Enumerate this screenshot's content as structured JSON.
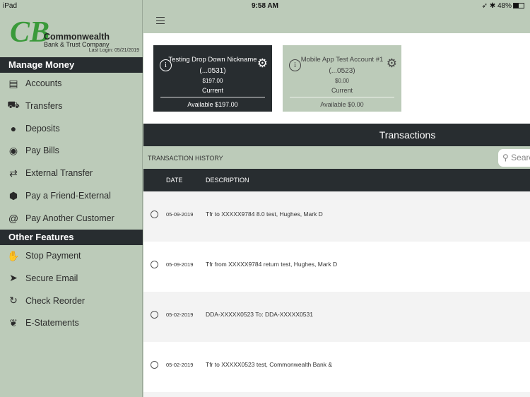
{
  "status": {
    "device": "iPad",
    "time": "9:58 AM",
    "battery": "48%"
  },
  "brand": {
    "name": "Commonwealth",
    "sub": "Bank & Trust Company",
    "last_login": "Last Login: 05/21/2019"
  },
  "sidebar": {
    "manage_header": "Manage Money",
    "manage_items": [
      {
        "label": "Accounts",
        "icon": "▤"
      },
      {
        "label": "Transfers",
        "icon": "⛟"
      },
      {
        "label": "Deposits",
        "icon": "●"
      },
      {
        "label": "Pay Bills",
        "icon": "◉"
      },
      {
        "label": "External Transfer",
        "icon": "⇄"
      },
      {
        "label": "Pay a Friend-External",
        "icon": "⬢"
      },
      {
        "label": "Pay Another Customer",
        "icon": "@"
      }
    ],
    "other_header": "Other Features",
    "other_items": [
      {
        "label": "Stop Payment",
        "icon": "✋"
      },
      {
        "label": "Secure Email",
        "icon": "➤"
      },
      {
        "label": "Check Reorder",
        "icon": "↻"
      },
      {
        "label": "E-Statements",
        "icon": "❦"
      }
    ]
  },
  "cards": [
    {
      "name": "Testing Drop Down Nickname",
      "acct": "(...0531)",
      "balance": "$197.00",
      "status": "Current",
      "available": "Available $197.00"
    },
    {
      "name": "Mobile App Test Account #1",
      "acct": "(...0523)",
      "balance": "$0.00",
      "status": "Current",
      "available": "Available $0.00"
    }
  ],
  "transactions": {
    "title": "Transactions",
    "history_label": "TRANSACTION HISTORY",
    "search_placeholder": "Search",
    "columns": [
      "DATE",
      "DESCRIPTION"
    ],
    "rows": [
      {
        "date": "05-09-2019",
        "desc": "Tfr to XXXXX9784 8.0 test, Hughes, Mark D"
      },
      {
        "date": "05-09-2019",
        "desc": "Tfr from XXXXX9784 return test, Hughes, Mark D"
      },
      {
        "date": "05-02-2019",
        "desc": "DDA-XXXXX0523 To: DDA-XXXXX0531"
      },
      {
        "date": "05-02-2019",
        "desc": "Tfr to XXXXX0523 test, Commonwealth Bank &"
      }
    ]
  }
}
